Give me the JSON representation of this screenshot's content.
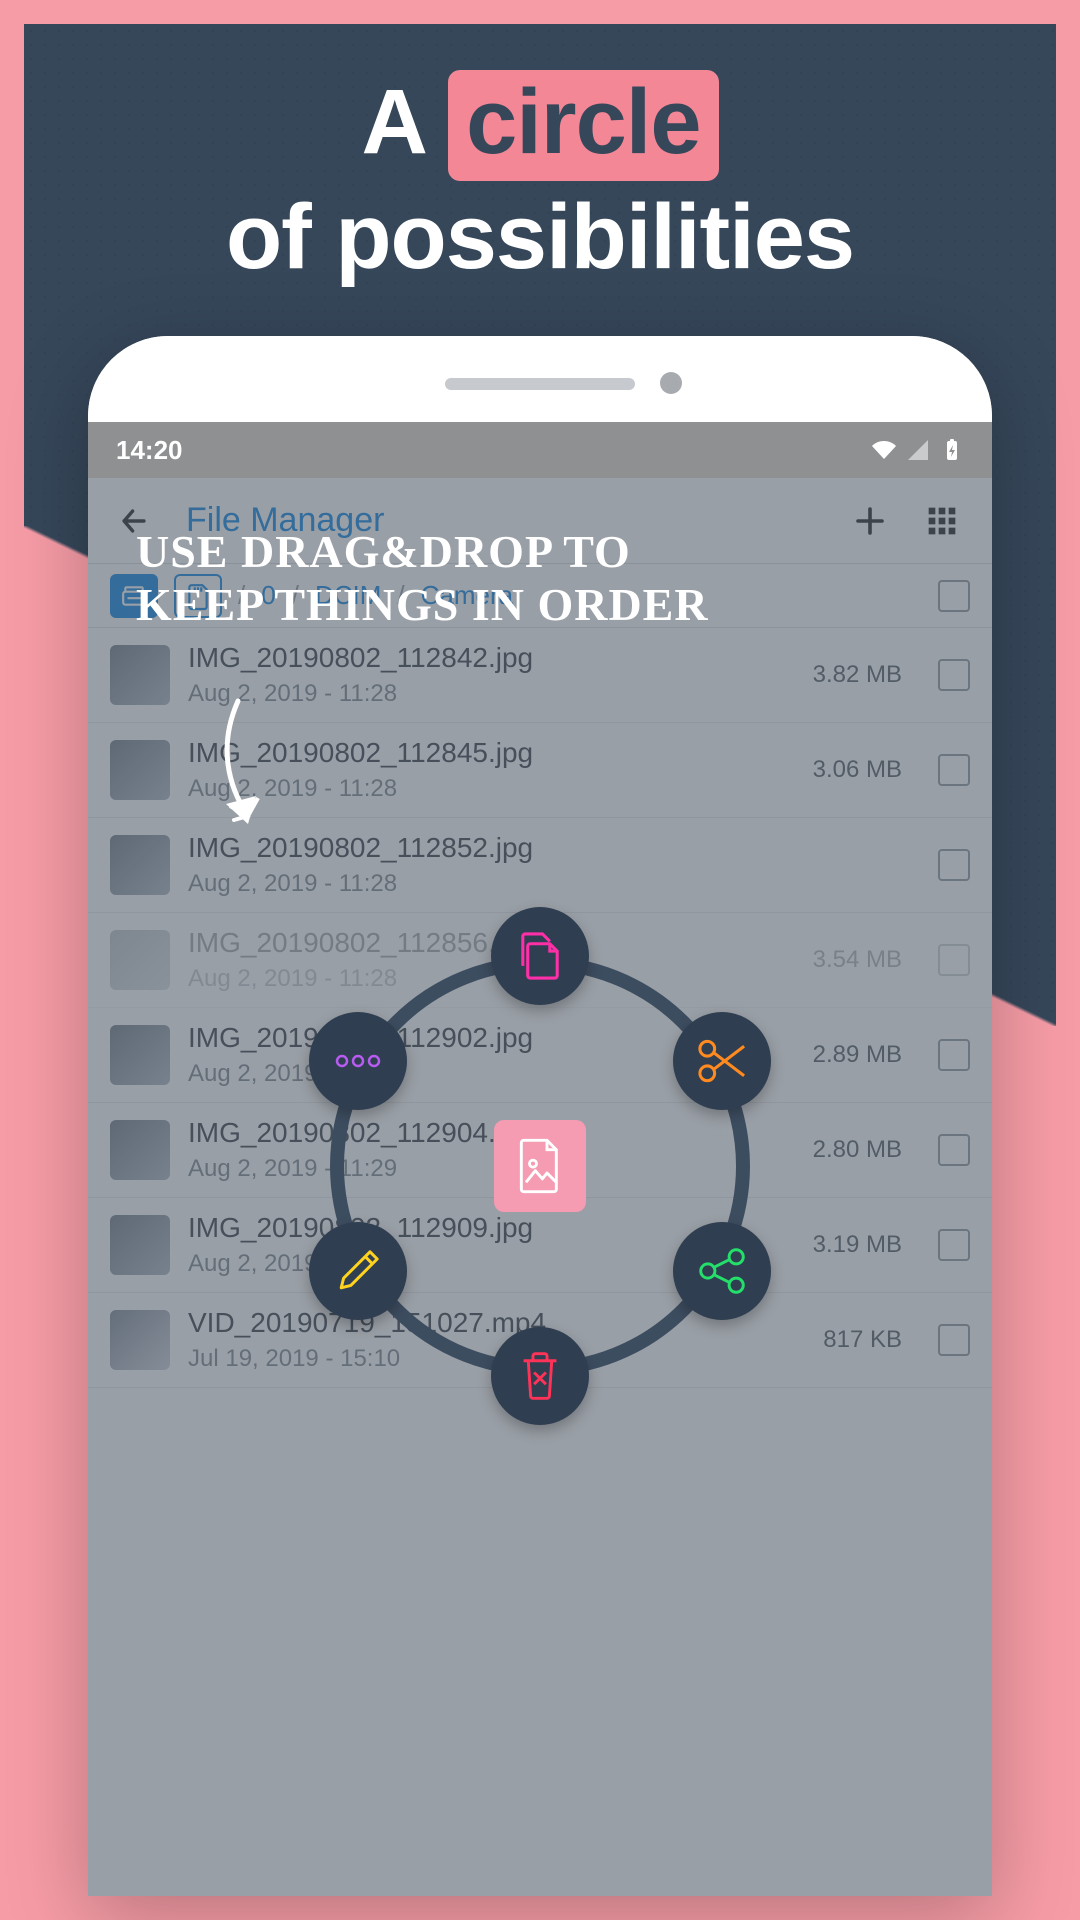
{
  "promo": {
    "line1_pre": "A ",
    "line1_pill": "circle",
    "line2": "of possibilities",
    "hint_line1": "Use drag&drop to",
    "hint_line2": "keep things in order"
  },
  "statusbar": {
    "time": "14:20"
  },
  "toolbar": {
    "title": "File Manager"
  },
  "breadcrumbs": {
    "items": [
      "0",
      "DCIM",
      "Camera"
    ]
  },
  "files": [
    {
      "name": "IMG_20190802_112842.jpg",
      "meta": "Aug 2, 2019 - 11:28",
      "size": "3.82 MB"
    },
    {
      "name": "IMG_20190802_112845.jpg",
      "meta": "Aug 2, 2019 - 11:28",
      "size": "3.06 MB"
    },
    {
      "name": "IMG_20190802_112852.jpg",
      "meta": "Aug 2, 2019 - 11:28",
      "size": ""
    },
    {
      "name": "IMG_20190802_112856.jpg",
      "meta": "Aug 2, 2019 - 11:28",
      "size": "3.54 MB"
    },
    {
      "name": "IMG_20190802_112902.jpg",
      "meta": "Aug 2, 2019 - 11:29",
      "size": "2.89 MB"
    },
    {
      "name": "IMG_20190802_112904.jpg",
      "meta": "Aug 2, 2019 - 11:29",
      "size": "2.80 MB"
    },
    {
      "name": "IMG_20190802_112909.jpg",
      "meta": "Aug 2, 2019 - 11:29",
      "size": "3.19 MB"
    },
    {
      "name": "VID_20190719_151027.mp4",
      "meta": "Jul 19, 2019 - 15:10",
      "size": "817 KB"
    }
  ],
  "radial": {
    "copy": "copy",
    "cut": "cut",
    "share": "share",
    "delete": "delete",
    "edit": "rename",
    "more": "more"
  }
}
